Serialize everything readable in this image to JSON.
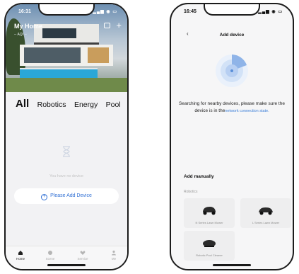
{
  "left_phone": {
    "status": {
      "time": "16:31"
    },
    "hero": {
      "home_name": "My Home",
      "weather": "--  AQI --"
    },
    "categories": [
      "All",
      "Robotics",
      "Energy",
      "Pool"
    ],
    "empty_text": "You have no device",
    "add_button_label": "Please Add Device",
    "tabs": [
      {
        "label": "Home",
        "icon": "home-icon"
      },
      {
        "label": "Scene",
        "icon": "scene-icon"
      },
      {
        "label": "Service",
        "icon": "heart-icon"
      },
      {
        "label": "Me",
        "icon": "person-icon"
      }
    ]
  },
  "right_phone": {
    "status": {
      "time": "16:45"
    },
    "nav_title": "Add device",
    "search_text": "Searching for nearby devices, please make sure the device is in the",
    "search_link": "network connection state.",
    "manual_title": "Add manually",
    "robotics_label": "Robotics",
    "products": [
      {
        "name": "N Series Lawn Mower"
      },
      {
        "name": "L Series Lawn Mower"
      },
      {
        "name": "Robotic Pool Cleaner"
      }
    ]
  },
  "colors": {
    "accent": "#2f6fd4",
    "link": "#3d7fd8",
    "radar": "#5a8fd8"
  }
}
